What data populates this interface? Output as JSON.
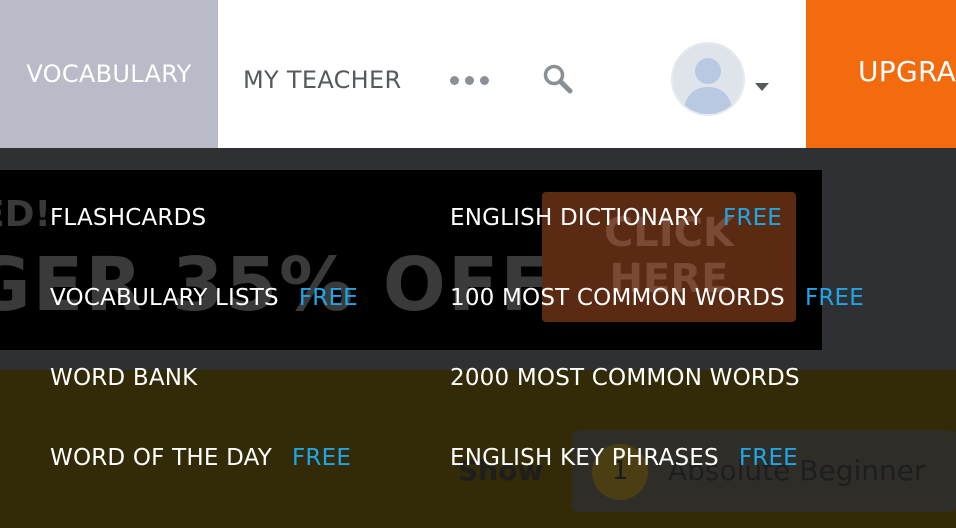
{
  "nav": {
    "vocabulary": "VOCABULARY",
    "my_teacher": "MY TEACHER",
    "upgrade": "UPGRADE"
  },
  "icons": {
    "more": "more-dots-icon",
    "search": "search-icon",
    "avatar": "user-avatar-icon",
    "caret": "caret-down-icon"
  },
  "colors": {
    "active_tab": "#b9bcc8",
    "upgrade": "#f26b0f",
    "free_badge": "#1fa6e6"
  },
  "background": {
    "banner_left": "ED!",
    "banner_main": "GER 35% OFF",
    "cta": [
      "CLICK",
      "HERE"
    ],
    "show": "Show",
    "level_number": "1",
    "level_name": "Absolute Beginner"
  },
  "menu": {
    "free_label": "FREE",
    "left": [
      {
        "label": "FLASHCARDS",
        "free": false
      },
      {
        "label": "VOCABULARY LISTS",
        "free": true
      },
      {
        "label": "WORD BANK",
        "free": false
      },
      {
        "label": "WORD OF THE DAY",
        "free": true
      }
    ],
    "right": [
      {
        "label": "ENGLISH DICTIONARY",
        "free": true
      },
      {
        "label": "100 MOST COMMON WORDS",
        "free": true
      },
      {
        "label": "2000 MOST COMMON WORDS",
        "free": false
      },
      {
        "label": "ENGLISH KEY PHRASES",
        "free": true
      }
    ]
  }
}
